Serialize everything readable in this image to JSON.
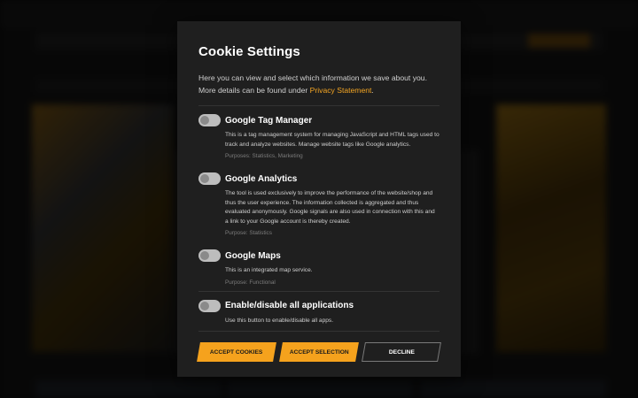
{
  "modal": {
    "title": "Cookie Settings",
    "intro_text": "Here you can view and select which information we save about you.  More details can be found under ",
    "privacy_link": "Privacy Statement",
    "intro_end": "."
  },
  "items": [
    {
      "name": "Google Tag Manager",
      "description": "This is a tag management system for managing JavaScript and HTML tags used to track and analyze websites. Manage website tags like Google analytics.",
      "purpose": "Purposes: Statistics, Marketing",
      "enabled": false
    },
    {
      "name": "Google Analytics",
      "description": "The tool is used exclusively to improve the performance of the website/shop and thus the user experience. The information collected is aggregated and thus evaluated anonymously. Google signals are also used in connection with this and a link to your Google account is thereby created.",
      "purpose": "Purpose: Statistics",
      "enabled": false
    },
    {
      "name": "Google Maps",
      "description": "This is an integrated map service.",
      "purpose": "Purpose: Functional",
      "enabled": false
    }
  ],
  "all_toggle": {
    "name": "Enable/disable all applications",
    "description": "Use this button to enable/disable all apps.",
    "enabled": false
  },
  "buttons": {
    "accept_cookies": "Accept cookies",
    "accept_selection": "Accept selection",
    "decline": "Decline"
  },
  "colors": {
    "accent": "#f5a21d",
    "modal_bg": "#1f1f1f",
    "toggle_off": "#bdbdbd"
  }
}
